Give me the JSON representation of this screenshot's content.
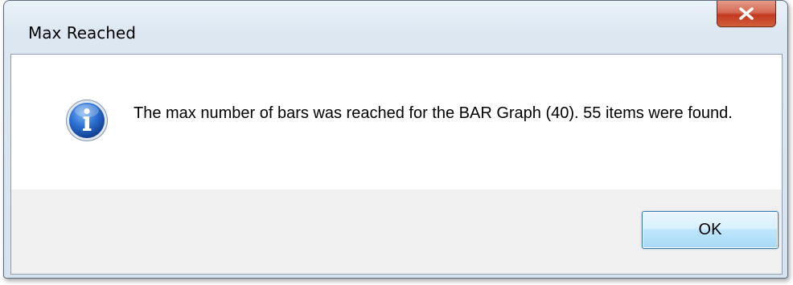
{
  "dialog": {
    "title": "Max Reached",
    "message": "The max number of bars was reached for the BAR Graph (40). 55 items were found.",
    "ok_label": "OK",
    "icon": "info-icon",
    "close_icon": "close-icon"
  },
  "colors": {
    "close_button": "#c2391f",
    "ok_button_border": "#3c7fb1",
    "info_icon": "#1f5fbf"
  }
}
